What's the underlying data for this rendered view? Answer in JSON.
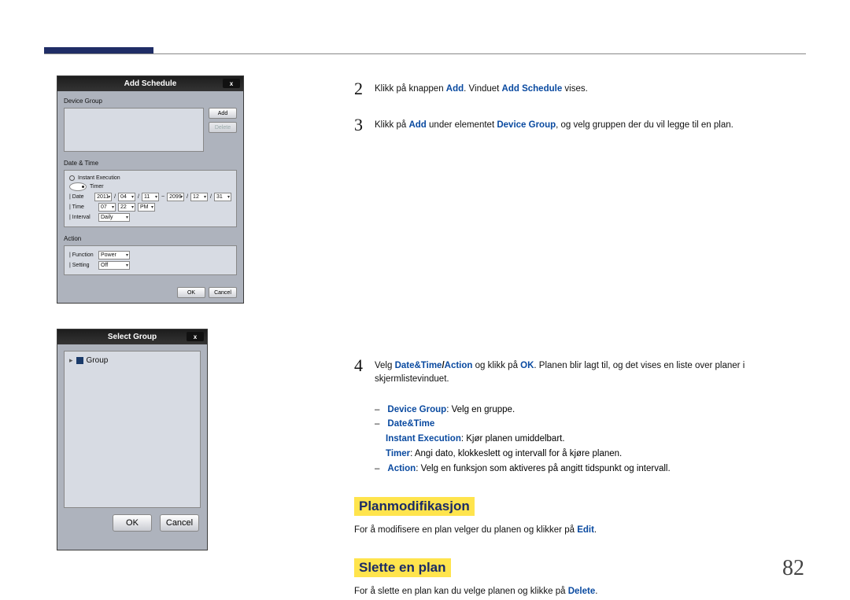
{
  "page_number": "82",
  "screenshots": {
    "add_schedule": {
      "title": "Add Schedule",
      "close": "x",
      "sections": {
        "device_group": "Device Group",
        "add_btn": "Add",
        "delete_btn": "Delete",
        "date_time": "Date & Time",
        "instant_execution": "Instant Execution",
        "timer": "Timer",
        "date_label": "| Date",
        "date_year": "2011",
        "date_m": "04",
        "date_d": "11",
        "date_y2": "2099",
        "date_m2": "12",
        "date_d2": "31",
        "time_label": "| Time",
        "time_h": "07",
        "time_m": "22",
        "time_ampm": "PM",
        "interval_label": "| Interval",
        "interval_val": "Daily",
        "action": "Action",
        "function_label": "| Function",
        "function_val": "Power",
        "setting_label": "| Setting",
        "setting_val": "Off",
        "ok": "OK",
        "cancel": "Cancel"
      }
    },
    "select_group": {
      "title": "Select Group",
      "close": "x",
      "group_item": "Group",
      "ok": "OK",
      "cancel": "Cancel"
    }
  },
  "steps": {
    "s2": {
      "num": "2",
      "pre": "Klikk på knappen ",
      "k1": "Add",
      "mid": ". Vinduet ",
      "k2": "Add Schedule",
      "post": " vises."
    },
    "s3": {
      "num": "3",
      "pre": "Klikk på ",
      "k1": "Add",
      "mid": " under elementet ",
      "k2": "Device Group",
      "post": ", og velg gruppen der du vil legge til en plan."
    },
    "s4": {
      "num": "4",
      "pre": "Velg ",
      "k1": "Date&Time",
      "sep": "/",
      "k2": "Action",
      "mid": " og klikk på ",
      "k3": "OK",
      "post": ". Planen blir lagt til, og det vises en liste over planer i skjermlistevinduet."
    }
  },
  "sublist": {
    "l1_k": "Device Group",
    "l1_t": ": Velg en gruppe.",
    "l2_k": "Date&Time",
    "l3_k": "Instant Execution",
    "l3_t": ": Kjør planen umiddelbart.",
    "l4_k": "Timer",
    "l4_t": ": Angi dato, klokkeslett og intervall for å kjøre planen.",
    "l5_k": "Action",
    "l5_t": ": Velg en funksjon som aktiveres på angitt tidspunkt og intervall."
  },
  "section_modify": {
    "title": "Planmodifikasjon",
    "p_pre": "For å modifisere en plan velger du planen og klikker på ",
    "p_k": "Edit",
    "p_post": "."
  },
  "section_delete": {
    "title": "Slette en plan",
    "p_pre": "For å slette en plan kan du velge planen og klikke på ",
    "p_k": "Delete",
    "p_post": "."
  }
}
